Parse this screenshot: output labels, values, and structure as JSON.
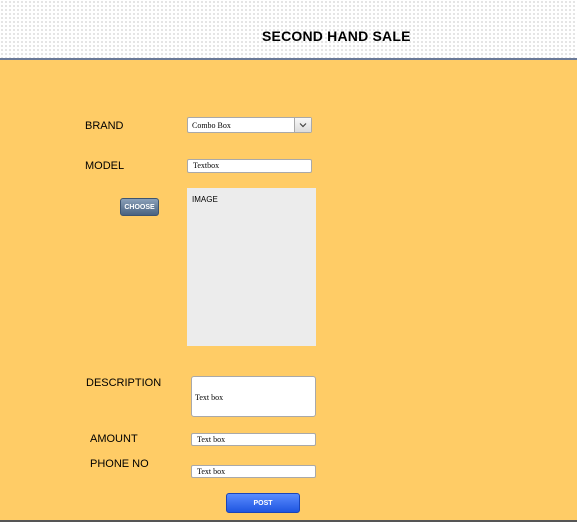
{
  "header": {
    "title": "SECOND HAND SALE"
  },
  "form": {
    "brand_label": "BRAND",
    "brand_value": "Combo Box",
    "model_label": "MODEL",
    "model_value": "Textbox",
    "choose_label": "CHOOSE",
    "image_label": "IMAGE",
    "description_label": "DESCRIPTION",
    "description_value": "Text box",
    "amount_label": "AMOUNT",
    "amount_value": "Text box",
    "phone_label": "PHONE NO",
    "phone_value": "Text box",
    "post_label": "POST"
  },
  "colors": {
    "main_background": "#ffcc66",
    "image_area": "#ececec",
    "choose_button": "#5a7290",
    "post_button": "#2d62f0"
  },
  "icons": {
    "combo_arrow": "chevron-down-icon"
  }
}
